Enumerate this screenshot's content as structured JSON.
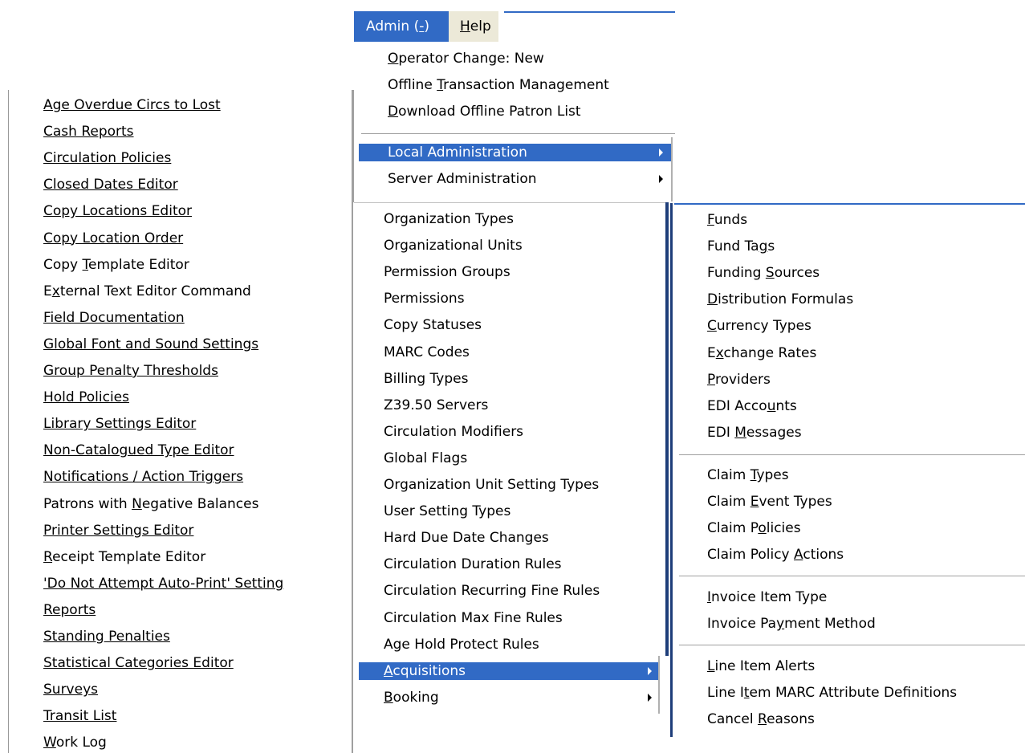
{
  "left_menu": {
    "items": [
      [
        "",
        "Age Overdue Circs to Lost",
        ""
      ],
      [
        "",
        "Cash Reports",
        ""
      ],
      [
        "",
        "Circulation Policies",
        ""
      ],
      [
        "",
        "Closed Dates Editor",
        ""
      ],
      [
        "",
        "Copy Locations Editor",
        ""
      ],
      [
        "",
        "Copy Location Order",
        ""
      ],
      [
        "Copy ",
        "T",
        "emplate Editor"
      ],
      [
        "E",
        "x",
        "ternal Text Editor Command"
      ],
      [
        "",
        "Field Documentation",
        ""
      ],
      [
        "",
        "Global Font and Sound Settings",
        ""
      ],
      [
        "",
        "Group Penalty Thresholds",
        ""
      ],
      [
        "",
        "Hold Policies",
        ""
      ],
      [
        "",
        "Library Settings Editor",
        ""
      ],
      [
        "",
        "Non-Catalogued Type Editor",
        ""
      ],
      [
        "",
        "Notifications / Action Triggers",
        ""
      ],
      [
        "Patrons with ",
        "N",
        "egative Balances"
      ],
      [
        "",
        "Printer Settings Editor",
        ""
      ],
      [
        "",
        "R",
        "eceipt Template Editor"
      ],
      [
        "",
        "'Do Not Attempt Auto-Print' Setting",
        ""
      ],
      [
        "",
        "Reports",
        ""
      ],
      [
        "",
        "Standing Penalties",
        ""
      ],
      [
        "",
        "Statistical Categories Editor",
        ""
      ],
      [
        "",
        "Surveys",
        ""
      ],
      [
        "",
        "Transit List",
        ""
      ],
      [
        "",
        "W",
        "ork Log"
      ]
    ]
  },
  "menubar": {
    "admin": {
      "before": "Admin (",
      "u": "-",
      "after": ")"
    },
    "help": {
      "before": "",
      "u": "H",
      "after": "elp"
    }
  },
  "admin_menu": {
    "items": [
      [
        "",
        "O",
        "perator Change: New"
      ],
      [
        "Offline ",
        "T",
        "ransaction Management"
      ],
      [
        "",
        "D",
        "ownload Offline Patron List"
      ]
    ],
    "local_admin": "Local Administration",
    "server_admin": "Server Administration"
  },
  "server_menu": {
    "items": [
      "Organization Types",
      "Organizational Units",
      "Permission Groups",
      "Permissions",
      "Copy Statuses",
      "MARC Codes",
      "Billing Types",
      "Z39.50 Servers",
      "Circulation Modifiers",
      "Global Flags",
      "Organization Unit Setting Types",
      "User Setting Types",
      "Hard Due Date Changes",
      "Circulation Duration Rules",
      "Circulation Recurring Fine Rules",
      "Circulation Max Fine Rules",
      "Age Hold Protect Rules"
    ],
    "acquisitions": {
      "before": "",
      "u": "A",
      "after": "cquisitions"
    },
    "booking": {
      "before": "",
      "u": "B",
      "after": "ooking"
    }
  },
  "acq_menu": {
    "groups": [
      [
        [
          "",
          "F",
          "unds"
        ],
        [
          "Fund Ta",
          "g",
          "s"
        ],
        [
          "Funding ",
          "S",
          "ources"
        ],
        [
          "",
          "D",
          "istribution Formulas"
        ],
        [
          "",
          "C",
          "urrency Types"
        ],
        [
          "E",
          "x",
          "change Rates"
        ],
        [
          "",
          "P",
          "roviders"
        ],
        [
          "EDI Acco",
          "u",
          "nts"
        ],
        [
          "EDI ",
          "M",
          "essages"
        ]
      ],
      [
        [
          "Claim ",
          "T",
          "ypes"
        ],
        [
          "Claim ",
          "E",
          "vent Types"
        ],
        [
          "Claim P",
          "o",
          "licies"
        ],
        [
          "Claim Policy ",
          "A",
          "ctions"
        ]
      ],
      [
        [
          "",
          "I",
          "nvoice Item Type"
        ],
        [
          "Invoice Pa",
          "y",
          "ment Method"
        ]
      ],
      [
        [
          "",
          "L",
          "ine Item Alerts"
        ],
        [
          "Line I",
          "t",
          "em MARC Attribute Definitions"
        ],
        [
          "Cancel ",
          "R",
          "easons"
        ]
      ]
    ]
  }
}
